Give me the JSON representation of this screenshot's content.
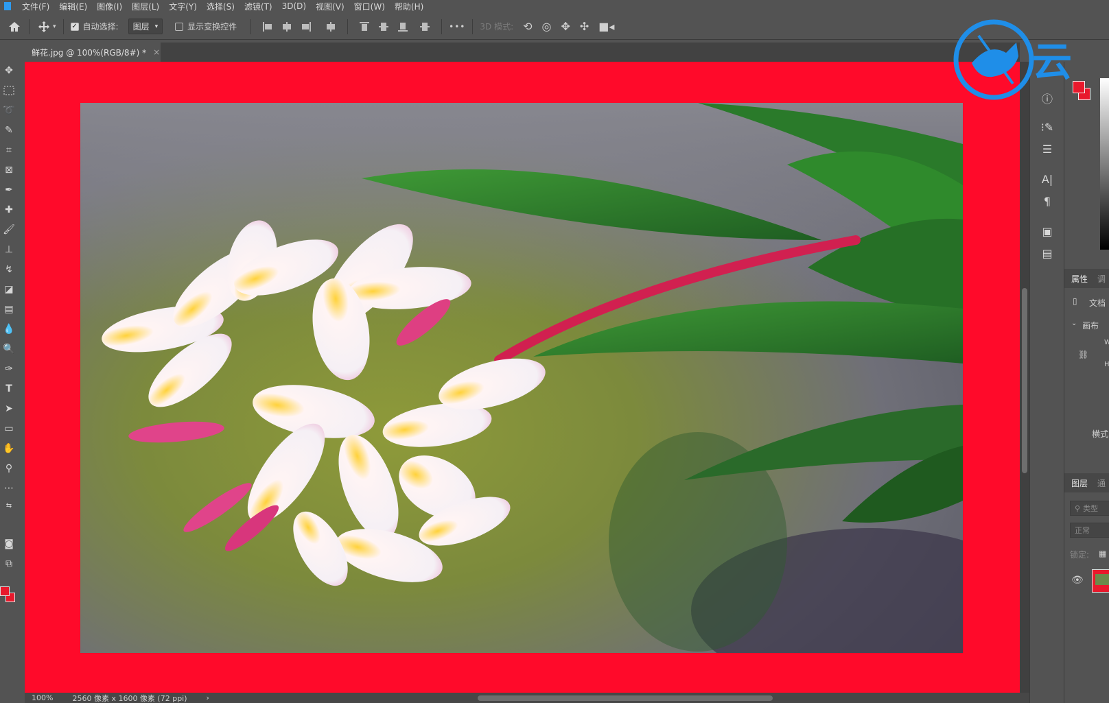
{
  "menu": [
    "文件(F)",
    "编辑(E)",
    "图像(I)",
    "图层(L)",
    "文字(Y)",
    "选择(S)",
    "滤镜(T)",
    "3D(D)",
    "视图(V)",
    "窗口(W)",
    "帮助(H)"
  ],
  "options": {
    "auto_select_label": "自动选择:",
    "auto_select_value": "图层",
    "show_transform_label": "显示变换控件",
    "more_label": "•••",
    "mode_3d_label": "3D 模式:"
  },
  "document": {
    "tab_title": "鲜花.jpg @ 100%(RGB/8#) *",
    "close_glyph": "×"
  },
  "status": {
    "zoom": "100%",
    "doc_info": "2560 像素 x 1600 像素 (72 ppi)",
    "arrow": "›"
  },
  "panels": {
    "properties_tab": "属性",
    "properties_tab2": "调",
    "doc_label": "文档",
    "canvas_section": "画布",
    "width_abbr": "W",
    "height_abbr": "H",
    "mode_label": "横式",
    "layers_tab": "图层",
    "layers_tab2": "通",
    "search_placeholder": "类型",
    "blend_mode": "正常",
    "lock_label": "锁定:"
  },
  "watermark": {
    "text": "云"
  },
  "colors": {
    "canvas_bg": "#ff0a2a",
    "foreground": "#e8192c",
    "background": "#e8192c",
    "ui_gray": "#535353",
    "watermark_blue": "#1f8ee8"
  },
  "icons": {
    "home": "home-icon",
    "move": "move-icon"
  }
}
